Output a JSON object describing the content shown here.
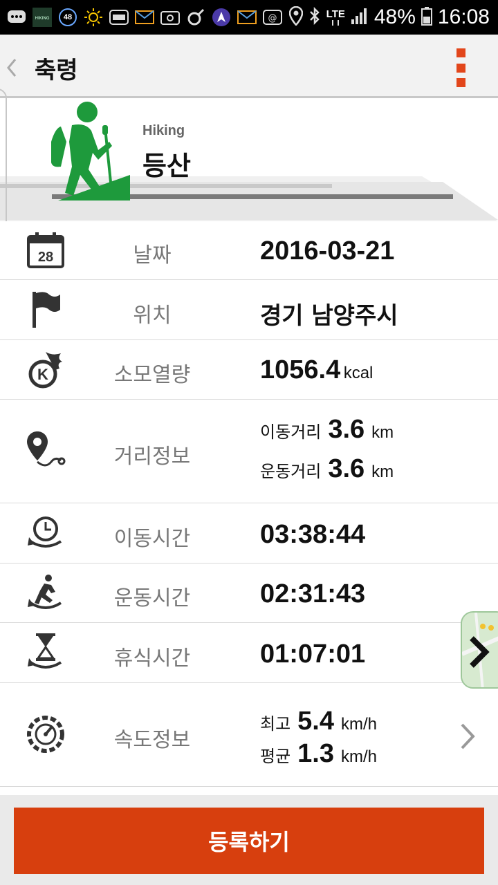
{
  "status_bar": {
    "notif_count": "48",
    "network": "LTE",
    "battery": "48%",
    "time": "16:08"
  },
  "app_bar": {
    "title": "축령"
  },
  "activity": {
    "sub": "Hiking",
    "title": "등산"
  },
  "rows": {
    "date": {
      "label": "날짜",
      "value": "2016-03-21",
      "icon_day": "28"
    },
    "location": {
      "label": "위치",
      "value": "경기 남양주시"
    },
    "calories": {
      "label": "소모열량",
      "value": "1056.4",
      "unit": "kcal"
    },
    "distance": {
      "label": "거리정보",
      "move_label": "이동거리",
      "move_value": "3.6",
      "move_unit": "km",
      "exercise_label": "운동거리",
      "exercise_value": "3.6",
      "exercise_unit": "km"
    },
    "move_time": {
      "label": "이동시간",
      "value": "03:38:44"
    },
    "exercise_time": {
      "label": "운동시간",
      "value": "02:31:43"
    },
    "rest_time": {
      "label": "휴식시간",
      "value": "01:07:01"
    },
    "speed": {
      "label": "속도정보",
      "max_label": "최고",
      "max_value": "5.4",
      "max_unit": "km/h",
      "avg_label": "평균",
      "avg_value": "1.3",
      "avg_unit": "km/h"
    }
  },
  "register_button": "등록하기",
  "colors": {
    "accent": "#d73f0e",
    "menu": "#e2461b",
    "hiker": "#1e9a3c"
  }
}
